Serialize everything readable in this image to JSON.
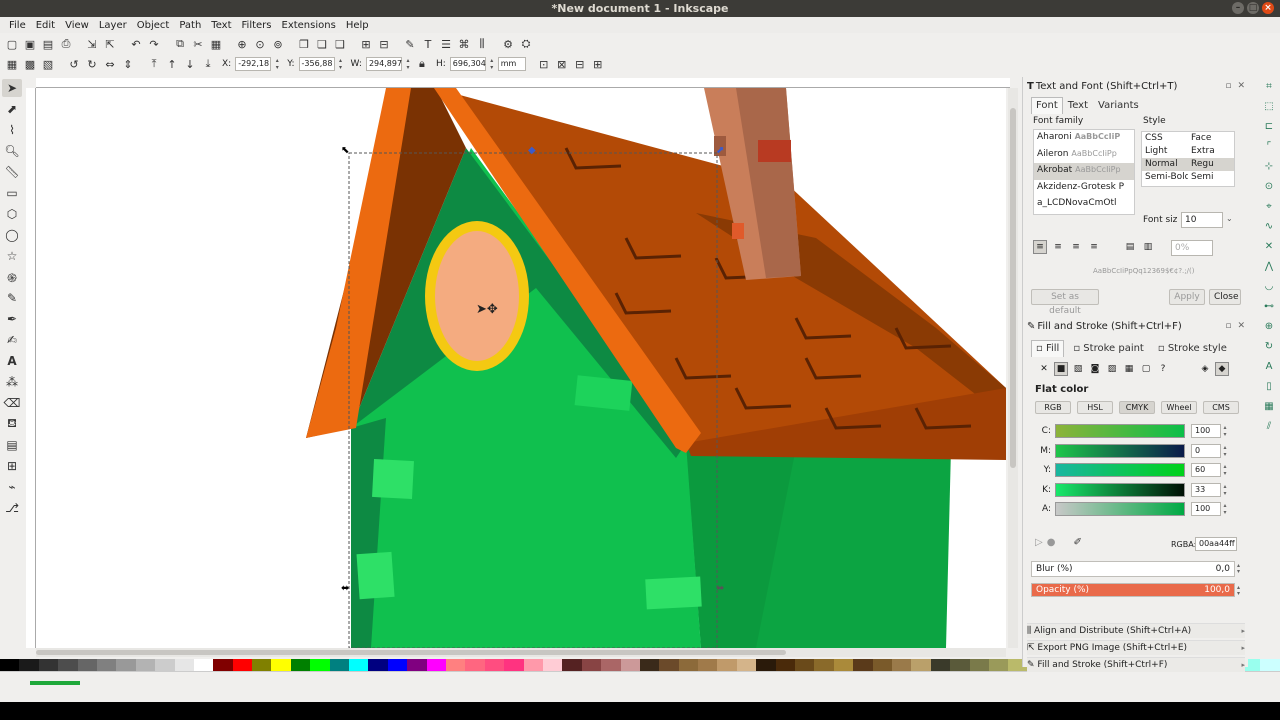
{
  "window": {
    "title": "*New document 1 - Inkscape"
  },
  "menu": [
    "File",
    "Edit",
    "View",
    "Layer",
    "Object",
    "Path",
    "Text",
    "Filters",
    "Extensions",
    "Help"
  ],
  "toolcontrols": {
    "x_label": "X:",
    "x_value": "-292,18",
    "y_label": "Y:",
    "y_value": "-356,88",
    "w_label": "W:",
    "w_value": "294,897",
    "h_label": "H:",
    "h_value": "696,304",
    "unit": "mm"
  },
  "text_font": {
    "title": "Text and Font (Shift+Ctrl+T)",
    "tabs": [
      "Font",
      "Text",
      "Variants"
    ],
    "font_family_label": "Font family",
    "fonts": [
      {
        "name": "Aharoni",
        "sample": "AaBbCcIiP"
      },
      {
        "name": "Aileron",
        "sample": "AaBbCcIiPp"
      },
      {
        "name": "Akrobat",
        "sample": "AaBbCcIiPp"
      },
      {
        "name": "Akzidenz-Grotesk P",
        "sample": ""
      },
      {
        "name": "a_LCDNovaCmOtl",
        "sample": ""
      }
    ],
    "style_label": "Style",
    "style_header": [
      "CSS",
      "Face"
    ],
    "styles": [
      [
        "Light",
        "Extra"
      ],
      [
        "Normal",
        "Regu"
      ],
      [
        "Semi-Bold",
        "Semi"
      ]
    ],
    "font_size_label": "Font siz",
    "font_size": "10",
    "spacing_value": "0%",
    "preview": "AaBbCcIiPpQq12369$€¢?.;/()",
    "set_default": "Set as default",
    "apply": "Apply",
    "close": "Close"
  },
  "fill_stroke": {
    "title": "Fill and Stroke (Shift+Ctrl+F)",
    "tabs": [
      "Fill",
      "Stroke paint",
      "Stroke style"
    ],
    "paint_type_label": "Flat color",
    "modes": [
      "RGB",
      "HSL",
      "CMYK",
      "Wheel",
      "CMS"
    ],
    "active_mode": "CMYK",
    "channels": [
      {
        "label": "C:",
        "value": "100",
        "from": "#8db33a",
        "to": "#0bbf49"
      },
      {
        "label": "M:",
        "value": "0",
        "from": "#1ec64a",
        "to": "#0a1a4a"
      },
      {
        "label": "Y:",
        "value": "60",
        "from": "#1ab6a0",
        "to": "#00d21a"
      },
      {
        "label": "K:",
        "value": "33",
        "from": "#19e86b",
        "to": "#001005"
      },
      {
        "label": "A:",
        "value": "100",
        "from": "#c8c8c8",
        "to": "#00aa44"
      }
    ],
    "rgba_label": "RGBA:",
    "rgba": "00aa44ff",
    "blur_label": "Blur (%)",
    "blur_value": "0,0",
    "opacity_label": "Opacity (%)",
    "opacity_value": "100,0"
  },
  "collapsed_docks": [
    "Align and Distribute (Shift+Ctrl+A)",
    "Export PNG Image (Shift+Ctrl+E)",
    "Fill and Stroke (Shift+Ctrl+F)"
  ],
  "colors": {
    "roof": "#b34a06",
    "roof_edge": "#ec6a10",
    "gable_dark": "#0d8a43",
    "wall_light": "#10c04e",
    "wall_right": "#0ca442",
    "window_fill": "#f4ab80",
    "window_ring": "#f4c912",
    "chimney": "#c97e5a",
    "accent_opacity": "#e96a4a"
  }
}
